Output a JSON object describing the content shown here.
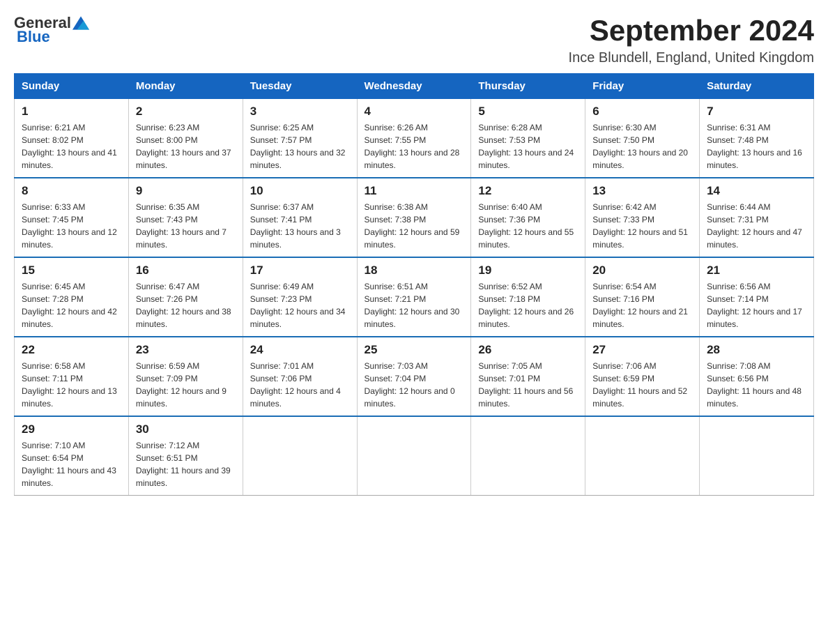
{
  "logo": {
    "general": "General",
    "blue": "Blue"
  },
  "title": "September 2024",
  "location": "Ince Blundell, England, United Kingdom",
  "weekdays": [
    "Sunday",
    "Monday",
    "Tuesday",
    "Wednesday",
    "Thursday",
    "Friday",
    "Saturday"
  ],
  "weeks": [
    [
      {
        "day": "1",
        "sunrise": "6:21 AM",
        "sunset": "8:02 PM",
        "daylight": "13 hours and 41 minutes."
      },
      {
        "day": "2",
        "sunrise": "6:23 AM",
        "sunset": "8:00 PM",
        "daylight": "13 hours and 37 minutes."
      },
      {
        "day": "3",
        "sunrise": "6:25 AM",
        "sunset": "7:57 PM",
        "daylight": "13 hours and 32 minutes."
      },
      {
        "day": "4",
        "sunrise": "6:26 AM",
        "sunset": "7:55 PM",
        "daylight": "13 hours and 28 minutes."
      },
      {
        "day": "5",
        "sunrise": "6:28 AM",
        "sunset": "7:53 PM",
        "daylight": "13 hours and 24 minutes."
      },
      {
        "day": "6",
        "sunrise": "6:30 AM",
        "sunset": "7:50 PM",
        "daylight": "13 hours and 20 minutes."
      },
      {
        "day": "7",
        "sunrise": "6:31 AM",
        "sunset": "7:48 PM",
        "daylight": "13 hours and 16 minutes."
      }
    ],
    [
      {
        "day": "8",
        "sunrise": "6:33 AM",
        "sunset": "7:45 PM",
        "daylight": "13 hours and 12 minutes."
      },
      {
        "day": "9",
        "sunrise": "6:35 AM",
        "sunset": "7:43 PM",
        "daylight": "13 hours and 7 minutes."
      },
      {
        "day": "10",
        "sunrise": "6:37 AM",
        "sunset": "7:41 PM",
        "daylight": "13 hours and 3 minutes."
      },
      {
        "day": "11",
        "sunrise": "6:38 AM",
        "sunset": "7:38 PM",
        "daylight": "12 hours and 59 minutes."
      },
      {
        "day": "12",
        "sunrise": "6:40 AM",
        "sunset": "7:36 PM",
        "daylight": "12 hours and 55 minutes."
      },
      {
        "day": "13",
        "sunrise": "6:42 AM",
        "sunset": "7:33 PM",
        "daylight": "12 hours and 51 minutes."
      },
      {
        "day": "14",
        "sunrise": "6:44 AM",
        "sunset": "7:31 PM",
        "daylight": "12 hours and 47 minutes."
      }
    ],
    [
      {
        "day": "15",
        "sunrise": "6:45 AM",
        "sunset": "7:28 PM",
        "daylight": "12 hours and 42 minutes."
      },
      {
        "day": "16",
        "sunrise": "6:47 AM",
        "sunset": "7:26 PM",
        "daylight": "12 hours and 38 minutes."
      },
      {
        "day": "17",
        "sunrise": "6:49 AM",
        "sunset": "7:23 PM",
        "daylight": "12 hours and 34 minutes."
      },
      {
        "day": "18",
        "sunrise": "6:51 AM",
        "sunset": "7:21 PM",
        "daylight": "12 hours and 30 minutes."
      },
      {
        "day": "19",
        "sunrise": "6:52 AM",
        "sunset": "7:18 PM",
        "daylight": "12 hours and 26 minutes."
      },
      {
        "day": "20",
        "sunrise": "6:54 AM",
        "sunset": "7:16 PM",
        "daylight": "12 hours and 21 minutes."
      },
      {
        "day": "21",
        "sunrise": "6:56 AM",
        "sunset": "7:14 PM",
        "daylight": "12 hours and 17 minutes."
      }
    ],
    [
      {
        "day": "22",
        "sunrise": "6:58 AM",
        "sunset": "7:11 PM",
        "daylight": "12 hours and 13 minutes."
      },
      {
        "day": "23",
        "sunrise": "6:59 AM",
        "sunset": "7:09 PM",
        "daylight": "12 hours and 9 minutes."
      },
      {
        "day": "24",
        "sunrise": "7:01 AM",
        "sunset": "7:06 PM",
        "daylight": "12 hours and 4 minutes."
      },
      {
        "day": "25",
        "sunrise": "7:03 AM",
        "sunset": "7:04 PM",
        "daylight": "12 hours and 0 minutes."
      },
      {
        "day": "26",
        "sunrise": "7:05 AM",
        "sunset": "7:01 PM",
        "daylight": "11 hours and 56 minutes."
      },
      {
        "day": "27",
        "sunrise": "7:06 AM",
        "sunset": "6:59 PM",
        "daylight": "11 hours and 52 minutes."
      },
      {
        "day": "28",
        "sunrise": "7:08 AM",
        "sunset": "6:56 PM",
        "daylight": "11 hours and 48 minutes."
      }
    ],
    [
      {
        "day": "29",
        "sunrise": "7:10 AM",
        "sunset": "6:54 PM",
        "daylight": "11 hours and 43 minutes."
      },
      {
        "day": "30",
        "sunrise": "7:12 AM",
        "sunset": "6:51 PM",
        "daylight": "11 hours and 39 minutes."
      },
      null,
      null,
      null,
      null,
      null
    ]
  ]
}
